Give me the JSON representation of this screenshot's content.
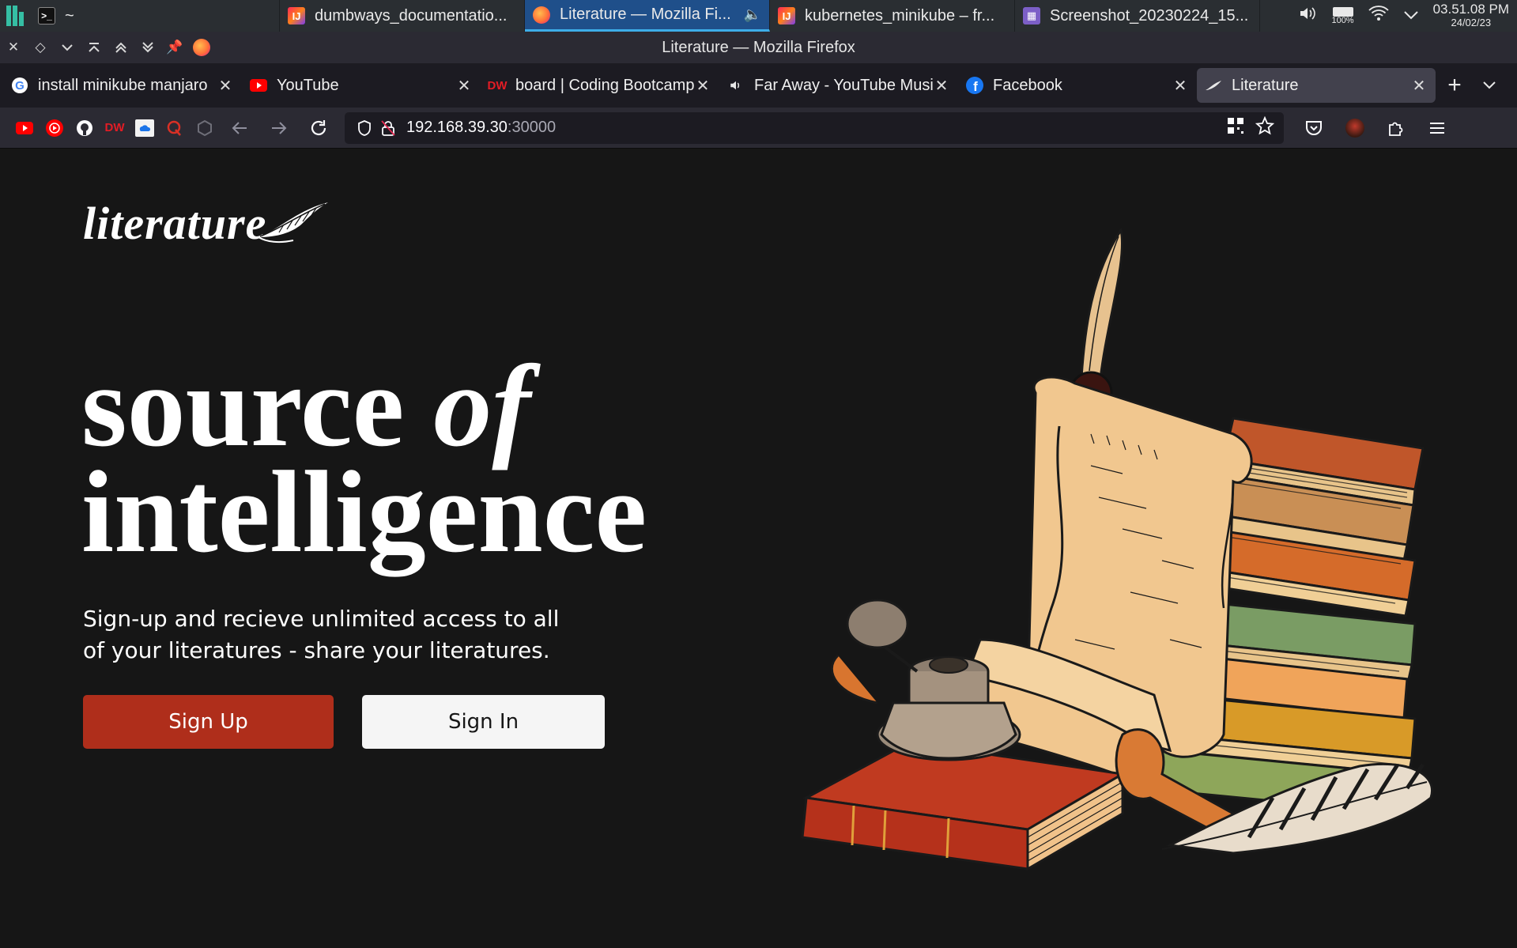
{
  "taskbar": {
    "tasks": [
      {
        "label": "~",
        "icon": "terminal-icon"
      },
      {
        "label": "dumbways_documentatio...",
        "icon": "intellij-icon"
      },
      {
        "label": "Literature — Mozilla Fi...",
        "icon": "firefox-icon",
        "active": true
      },
      {
        "label": "kubernetes_minikube – fr...",
        "icon": "intellij-icon"
      },
      {
        "label": "Screenshot_20230224_15...",
        "icon": "image-viewer-icon"
      }
    ],
    "battery": "100%",
    "time": "03.51.08 PM",
    "date": "24/02/23"
  },
  "window": {
    "title": "Literature — Mozilla Firefox"
  },
  "tabs": [
    {
      "title": "install minikube manjaro",
      "favicon": "google-icon"
    },
    {
      "title": "YouTube",
      "favicon": "youtube-icon"
    },
    {
      "title": "board | Coding Bootcamp",
      "favicon": "dumbways-icon"
    },
    {
      "title": "Far Away - YouTube Music",
      "favicon": "speaker-icon"
    },
    {
      "title": "Facebook",
      "favicon": "facebook-icon"
    },
    {
      "title": "Literature",
      "favicon": "feather-icon",
      "selected": true
    }
  ],
  "navbar": {
    "url_host": "192.168.39.30",
    "url_port": ":30000"
  },
  "page": {
    "logo_text": "literature",
    "title_line1_word1": "source",
    "title_line1_word2": "of",
    "title_line2": "intelligence",
    "subtitle": "Sign-up and recieve unlimited access to all of your literatures - share your literatures.",
    "signup_label": "Sign Up",
    "signin_label": "Sign In"
  },
  "colors": {
    "page_bg": "#161616",
    "signup_bg": "#af2e1b",
    "signin_bg": "#f5f5f5",
    "taskbar_active": "#1f4f8a",
    "accent": "#3daee9"
  }
}
